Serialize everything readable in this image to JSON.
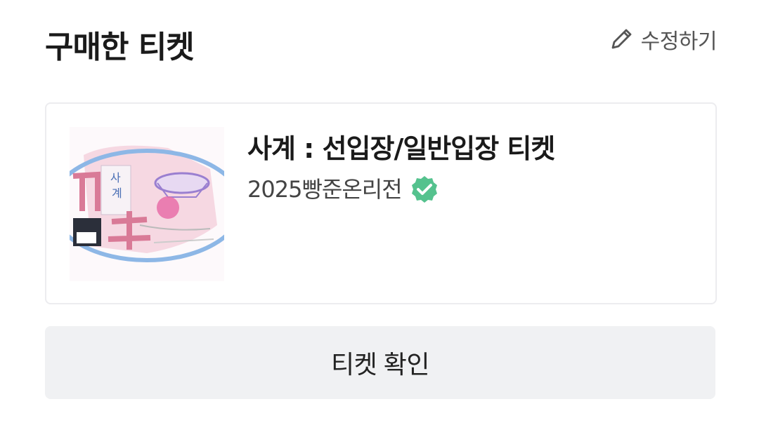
{
  "header": {
    "title": "구매한 티켓",
    "edit_label": "수정하기",
    "edit_icon": "pencil-icon"
  },
  "ticket": {
    "title": "사계 : 선입장/일반입장 티켓",
    "seller": "2025빵준온리전",
    "verified_icon": "verified-badge-icon",
    "thumbnail": {
      "text_vertical": "사계"
    }
  },
  "actions": {
    "confirm_label": "티켓 확인"
  },
  "colors": {
    "verified": "#55c28e",
    "button_bg": "#f0f1f3",
    "card_border": "#ececef"
  }
}
